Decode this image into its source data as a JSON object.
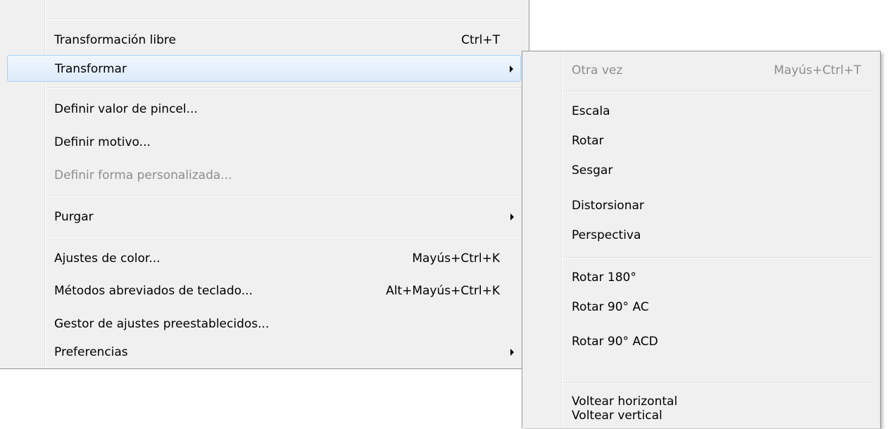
{
  "main_menu": {
    "items": [
      {
        "label": "Transformación libre",
        "shortcut": "Ctrl+T"
      },
      {
        "label": "Transformar",
        "submenu": true,
        "highlighted": true
      },
      {
        "label": "Definir valor de pincel..."
      },
      {
        "label": "Definir motivo..."
      },
      {
        "label": "Definir forma personalizada...",
        "disabled": true
      },
      {
        "label": "Purgar",
        "submenu": true
      },
      {
        "label": "Ajustes de color...",
        "shortcut": "Mayús+Ctrl+K"
      },
      {
        "label": "Métodos abreviados de teclado...",
        "shortcut": "Alt+Mayús+Ctrl+K"
      },
      {
        "label": "Gestor de ajustes preestablecidos..."
      },
      {
        "label": "Preferencias",
        "submenu": true
      }
    ]
  },
  "submenu": {
    "title": "Transformar",
    "items": [
      {
        "label": "Otra vez",
        "shortcut": "Mayús+Ctrl+T",
        "disabled": true
      },
      {
        "label": "Escala"
      },
      {
        "label": "Rotar"
      },
      {
        "label": "Sesgar"
      },
      {
        "label": "Distorsionar"
      },
      {
        "label": "Perspectiva"
      },
      {
        "label": "Rotar 180°"
      },
      {
        "label": "Rotar 90° AC"
      },
      {
        "label": "Rotar 90° ACD"
      },
      {
        "label": "Voltear horizontal"
      },
      {
        "label": "Voltear vertical"
      }
    ]
  },
  "colors": {
    "menu_background": "#f0f0f0",
    "highlight_border": "#a8d0f5",
    "disabled_text": "#8d8d8d"
  }
}
